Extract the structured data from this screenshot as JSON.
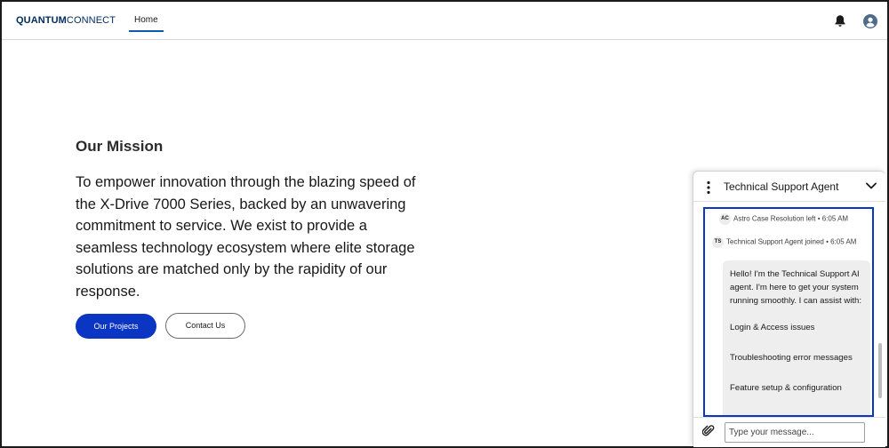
{
  "header": {
    "brand_bold": "QUANTUM",
    "brand_regular": "CONNECT",
    "nav_home": "Home",
    "icons": [
      "bell-icon",
      "user-avatar-icon"
    ]
  },
  "mission": {
    "title": "Our Mission",
    "text": "To empower innovation through the blazing speed of the X-Drive 7000 Series, backed by an unwavering commitment to service. We exist to provide a seamless technology ecosystem where elite storage solutions are matched only by the rapidity of our response.",
    "primary_button": "Our Projects",
    "secondary_button": "Contact Us"
  },
  "chat": {
    "title": "Technical Support Agent",
    "events": [
      {
        "initials": "AC",
        "text": "Astro Case Resolution left • 6:05 AM"
      },
      {
        "initials": "TS",
        "text": "Technical Support Agent joined • 6:05 AM"
      }
    ],
    "message": {
      "intro": "Hello! I'm the Technical Support AI agent. I'm here to get your system running smoothly. I can assist with:",
      "items": [
        "Login & Access issues",
        "Troubleshooting error messages",
        "Feature setup & configuration"
      ]
    },
    "input_placeholder": "Type your message...",
    "colors": {
      "accent": "#0b36c4",
      "bubble": "#eeeeee"
    }
  }
}
